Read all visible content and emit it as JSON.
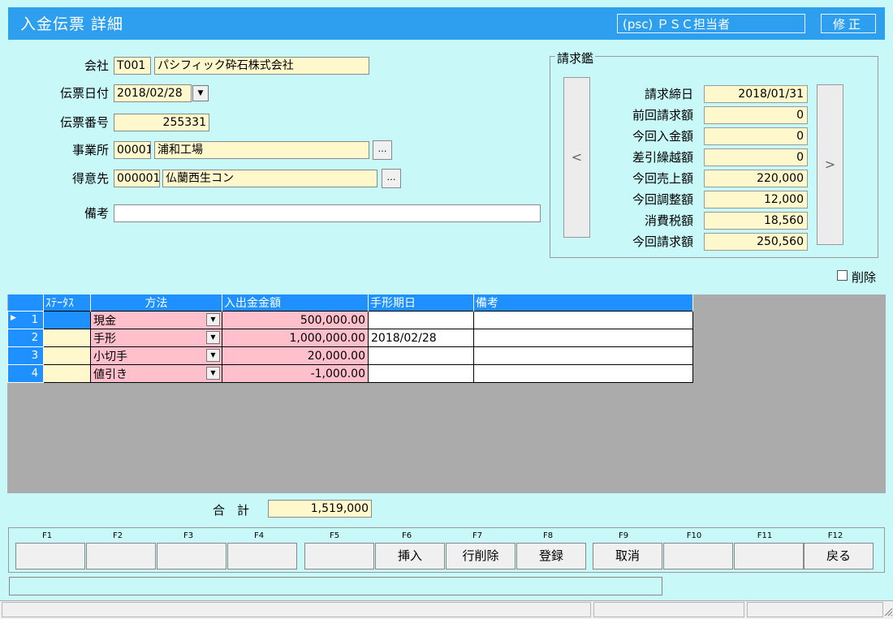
{
  "window": {
    "title": "入金伝票 詳細",
    "user": "(psc) ＰＳＣ担当者",
    "mode": "修正"
  },
  "header": {
    "company_label": "会社",
    "company_code": "T001",
    "company_name": "パシフィック砕石株式会社",
    "date_label": "伝票日付",
    "date_value": "2018/02/28",
    "slip_no_label": "伝票番号",
    "slip_no_value": "255331",
    "office_label": "事業所",
    "office_code": "00001",
    "office_name": "浦和工場",
    "customer_label": "得意先",
    "customer_code": "000001",
    "customer_name": "仏蘭西生コン",
    "remarks_label": "備考",
    "remarks_value": "",
    "ellipsis": "…"
  },
  "billing": {
    "group_title": "請求鑑",
    "prev_label": "<",
    "next_label": ">",
    "rows": [
      {
        "label": "請求締日",
        "value": "2018/01/31"
      },
      {
        "label": "前回請求額",
        "value": "0"
      },
      {
        "label": "今回入金額",
        "value": "0"
      },
      {
        "label": "差引繰越額",
        "value": "0"
      },
      {
        "label": "今回売上額",
        "value": "220,000"
      },
      {
        "label": "今回調整額",
        "value": "12,000"
      },
      {
        "label": "消費税額",
        "value": "18,560"
      },
      {
        "label": "今回請求額",
        "value": "250,560"
      }
    ]
  },
  "delete_checkbox": {
    "label": "削除",
    "checked": false
  },
  "grid": {
    "columns": [
      "ｽﾃｰﾀｽ",
      "方法",
      "入出金金額",
      "手形期日",
      "備考"
    ],
    "rows": [
      {
        "no": "1",
        "status": "",
        "method": "現金",
        "amount": "500,000.00",
        "due": "",
        "note": ""
      },
      {
        "no": "2",
        "status": "",
        "method": "手形",
        "amount": "1,000,000.00",
        "due": "2018/02/28",
        "note": ""
      },
      {
        "no": "3",
        "status": "",
        "method": "小切手",
        "amount": "20,000.00",
        "due": "",
        "note": ""
      },
      {
        "no": "4",
        "status": "",
        "method": "値引き",
        "amount": "-1,000.00",
        "due": "",
        "note": ""
      }
    ]
  },
  "total": {
    "label": "合　計",
    "value": "1,519,000"
  },
  "function_keys": [
    {
      "key": "F1",
      "label": ""
    },
    {
      "key": "F2",
      "label": ""
    },
    {
      "key": "F3",
      "label": ""
    },
    {
      "key": "F4",
      "label": ""
    },
    {
      "key": "F5",
      "label": ""
    },
    {
      "key": "F6",
      "label": "挿入"
    },
    {
      "key": "F7",
      "label": "行削除"
    },
    {
      "key": "F8",
      "label": "登録"
    },
    {
      "key": "F9",
      "label": "取消"
    },
    {
      "key": "F10",
      "label": ""
    },
    {
      "key": "F11",
      "label": ""
    },
    {
      "key": "F12",
      "label": "戻る"
    }
  ],
  "colors": {
    "background": "#c8f8f8",
    "titlebar": "#2e9fef",
    "input_readonly": "#fff8cc",
    "grid_header": "#1e90ff",
    "grid_editable": "#ffc0cb"
  }
}
